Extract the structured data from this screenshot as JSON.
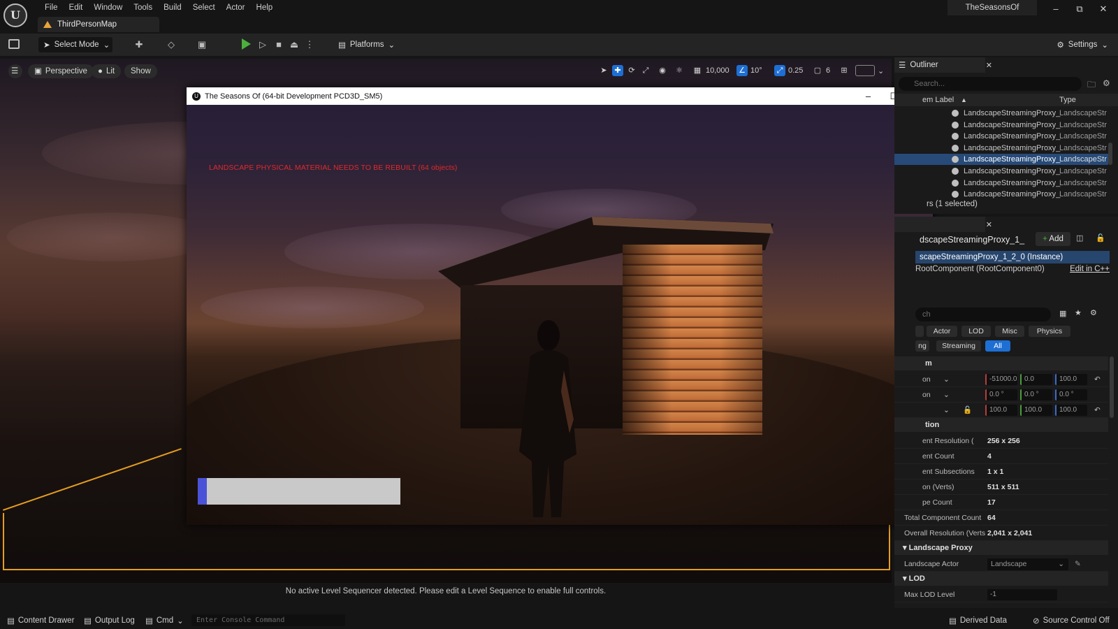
{
  "menu": [
    "File",
    "Edit",
    "Window",
    "Tools",
    "Build",
    "Select",
    "Actor",
    "Help"
  ],
  "project_name": "TheSeasonsOf",
  "level_tab": "ThirdPersonMap",
  "toolbar": {
    "select_mode": "Select Mode",
    "platforms": "Platforms",
    "settings": "Settings"
  },
  "viewport": {
    "perspective": "Perspective",
    "lit": "Lit",
    "show": "Show",
    "grid_snap": "10,000",
    "rotation_snap": "10°",
    "scale_snap": "0.25",
    "camera_speed": "6",
    "sequencer_message": "No active Level Sequencer detected. Please edit a Level Sequence to enable full controls."
  },
  "game_window": {
    "title": "The Seasons Of (64-bit Development PCD3D_SM5)",
    "warning": "LANDSCAPE PHYSICAL MATERIAL NEEDS TO BE REBUILT (64 objects)",
    "loading_progress": 0.045
  },
  "outliner": {
    "title": "Outliner",
    "search_placeholder": "Search...",
    "col_label": "em Label",
    "col_type": "Type",
    "rows": [
      {
        "label": "LandscapeStreamingProxy_",
        "type": "LandscapeStr",
        "selected": false
      },
      {
        "label": "LandscapeStreamingProxy_",
        "type": "LandscapeStr",
        "selected": false
      },
      {
        "label": "LandscapeStreamingProxy_",
        "type": "LandscapeStr",
        "selected": false
      },
      {
        "label": "LandscapeStreamingProxy_",
        "type": "LandscapeStr",
        "selected": false
      },
      {
        "label": "LandscapeStreamingProxy_",
        "type": "LandscapeStr",
        "selected": true
      },
      {
        "label": "LandscapeStreamingProxy_",
        "type": "LandscapeStr",
        "selected": false
      },
      {
        "label": "LandscapeStreamingProxy_",
        "type": "LandscapeStr",
        "selected": false
      },
      {
        "label": "LandscapeStreamingProxy_",
        "type": "LandscapeStr",
        "selected": false
      }
    ],
    "status": "rs (1 selected)"
  },
  "details": {
    "actor_name": "dscapeStreamingProxy_1_",
    "add_label": "Add",
    "instance_row": "scapeStreamingProxy_1_2_0 (Instance)",
    "root_component": "RootComponent (RootComponent0)",
    "edit_cpp": "Edit in C++",
    "search_placeholder": "ch",
    "filters_row1": [
      "Actor",
      "LOD",
      "Misc",
      "Physics"
    ],
    "filters_row2": [
      "ng",
      "Streaming",
      "All"
    ],
    "transform_section": "m",
    "location_label": "on",
    "rotation_label": "on",
    "location": [
      "-51000.0",
      "0.0",
      "100.0"
    ],
    "rotation": [
      "0.0 °",
      "0.0 °",
      "0.0 °"
    ],
    "scale": [
      "100.0",
      "100.0",
      "100.0"
    ],
    "info_section": "tion",
    "properties": [
      {
        "label": "ent Resolution (",
        "value": "256 x 256"
      },
      {
        "label": "ent Count",
        "value": "4"
      },
      {
        "label": "ent Subsections",
        "value": "1 x 1"
      },
      {
        "label": "on (Verts)",
        "value": "511 x 511"
      },
      {
        "label": "pe Count",
        "value": "17"
      },
      {
        "label": "Total Component Count",
        "value": "64"
      },
      {
        "label": "Overall Resolution (Verts",
        "value": "2,041 x 2,041"
      }
    ],
    "landscape_proxy_section": "Landscape Proxy",
    "landscape_actor_label": "Landscape Actor",
    "landscape_actor_value": "Landscape",
    "lod_section": "LOD",
    "max_lod_label": "Max LOD Level",
    "max_lod_value": "-1"
  },
  "bottom": {
    "content_drawer": "Content Drawer",
    "output_log": "Output Log",
    "cmd": "Cmd",
    "console_placeholder": "Enter Console Command",
    "derived_data": "Derived Data",
    "source_control": "Source Control Off"
  }
}
